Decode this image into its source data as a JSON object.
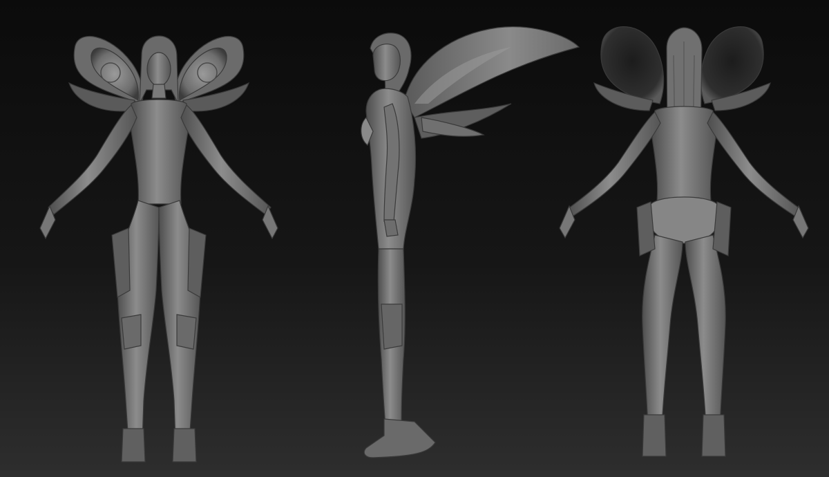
{
  "scene": {
    "background_top": "#0b0b0b",
    "background_bottom": "#2e2e2e",
    "figure_views": [
      "front",
      "side",
      "back"
    ],
    "skin_color": "#7e7e7e",
    "wing_color": "#6a6a6a",
    "shadow_color": "#2b2b2b"
  }
}
